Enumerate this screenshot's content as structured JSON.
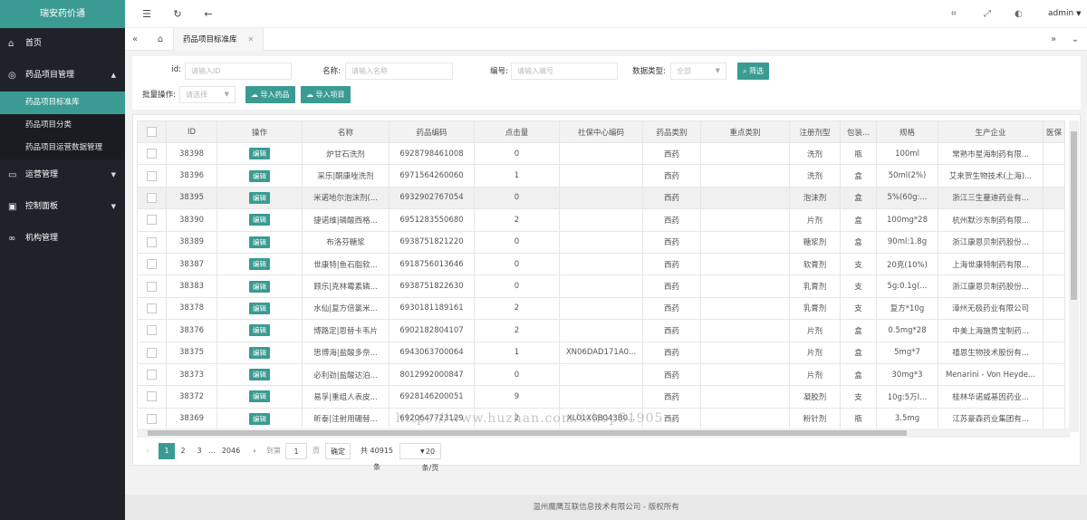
{
  "app": {
    "title": "瑞安药价通"
  },
  "sidebar": {
    "home": "首页",
    "drug_mgmt": "药品项目管理",
    "sub_items": [
      "药品项目标准库",
      "药品项目分类",
      "药品项目运营数据管理"
    ],
    "ops_mgmt": "运营管理",
    "control_panel": "控制面板",
    "org_mgmt": "机构管理"
  },
  "header": {
    "user": "admin"
  },
  "tabs": {
    "active": "药品项目标准库"
  },
  "filter": {
    "id_label": "id:",
    "id_placeholder": "请输入ID",
    "name_label": "名称:",
    "name_placeholder": "请输入名称",
    "code_label": "编号:",
    "code_placeholder": "请输入编号",
    "type_label": "数据类型:",
    "type_value": "全部",
    "filter_btn": "筛选",
    "batch_label": "批量操作:",
    "batch_value": "请选择",
    "import_drug": "导入药品",
    "import_item": "导入项目"
  },
  "table": {
    "headers": [
      "ID",
      "操作",
      "名称",
      "药品编码",
      "点击量",
      "社保中心编码",
      "药品类别",
      "重点类别",
      "注册剂型",
      "包装...",
      "规格",
      "生产企业",
      "医保"
    ],
    "edit_label": "编辑",
    "rows": [
      [
        "38398",
        "炉甘石洗剂",
        "6928798461008",
        "0",
        "",
        "西药",
        "",
        "洗剂",
        "瓶",
        "100ml",
        "常熟市星海制药有限..."
      ],
      [
        "38396",
        "采乐|酮康唑洗剂",
        "6971564260060",
        "1",
        "",
        "西药",
        "",
        "洗剂",
        "盒",
        "50ml(2%)",
        "艾来贺生物技术(上海)..."
      ],
      [
        "38395",
        "米诺地尔泡沫剂(...",
        "6932902767054",
        "0",
        "",
        "西药",
        "",
        "泡沫剂",
        "盒",
        "5%(60g:...",
        "浙江三生蔓迪药业有..."
      ],
      [
        "38390",
        "捷诺维|磷酸西格...",
        "6951283550680",
        "2",
        "",
        "西药",
        "",
        "片剂",
        "盒",
        "100mg*28",
        "杭州默沙东制药有限..."
      ],
      [
        "38389",
        "布洛芬糖浆",
        "6938751821220",
        "0",
        "",
        "西药",
        "",
        "糖浆剂",
        "盒",
        "90ml:1.8g",
        "浙江康恩贝制药股份..."
      ],
      [
        "38387",
        "世康特|鱼石脂软...",
        "6918756013646",
        "0",
        "",
        "西药",
        "",
        "软膏剂",
        "支",
        "20克(10%)",
        "上海世康特制药有限..."
      ],
      [
        "38383",
        "顾乐|克林霉素磷...",
        "6938751822630",
        "0",
        "",
        "西药",
        "",
        "乳膏剂",
        "支",
        "5g:0.1g(...",
        "浙江康恩贝制药股份..."
      ],
      [
        "38378",
        "水仙|复方倍氯米...",
        "6930181189161",
        "2",
        "",
        "西药",
        "",
        "乳膏剂",
        "支",
        "复方*10g",
        "漳州无极药业有限公司"
      ],
      [
        "38376",
        "博路定|恩替卡韦片",
        "6902182804107",
        "2",
        "",
        "西药",
        "",
        "片剂",
        "盒",
        "0.5mg*28",
        "中美上海施贵宝制药..."
      ],
      [
        "38375",
        "思博海|盐酸多奈...",
        "6943063700064",
        "1",
        "XN06DAD171A0...",
        "西药",
        "",
        "片剂",
        "盒",
        "5mg*7",
        "禧恩生物技术股份有..."
      ],
      [
        "38373",
        "必利劲|盐酸达泊...",
        "8012992000847",
        "0",
        "",
        "西药",
        "",
        "片剂",
        "盒",
        "30mg*3",
        "Menarini - Von Heyde..."
      ],
      [
        "38372",
        "易孚|重组人表皮...",
        "6928146200051",
        "9",
        "",
        "西药",
        "",
        "凝胶剂",
        "支",
        "10g:5万I...",
        "桂林华诺威基因药业..."
      ],
      [
        "38369",
        "昕泰|注射用硼替...",
        "6920647723129",
        "2",
        "XL01XGB043B0...",
        "西药",
        "",
        "粉针剂",
        "瓶",
        "3.5mg",
        "江苏豪森药业集团有..."
      ]
    ]
  },
  "pager": {
    "p1": "1",
    "p2": "2",
    "p3": "3",
    "dots": "...",
    "last": "2046",
    "goto": "到第",
    "page_val": "1",
    "page_unit": "页",
    "confirm": "确定",
    "total": "共 40915 条",
    "per_page": "20 条/页"
  },
  "footer": {
    "text": "温州魔鹰互联信息技术有限公司 - 版权所有"
  },
  "watermark": "https://www.huzhan.com/ishop51905"
}
